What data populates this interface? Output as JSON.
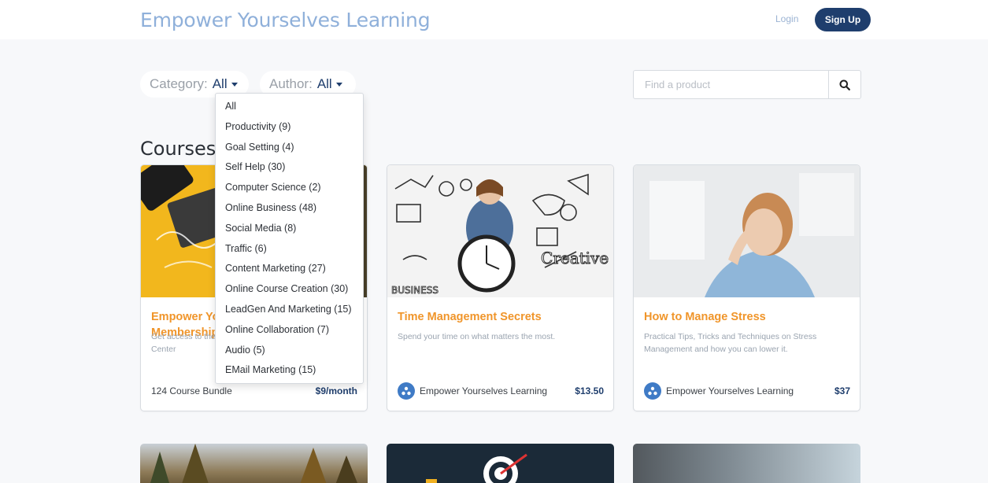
{
  "header": {
    "brand": "Empower Yourselves Learning",
    "login_label": "Login",
    "signup_label": "Sign Up"
  },
  "filters": {
    "category_label": "Category:",
    "category_value": "All",
    "author_label": "Author:",
    "author_value": "All"
  },
  "search": {
    "placeholder": "Find a product",
    "value": ""
  },
  "section_title": "Courses",
  "category_options": [
    "All",
    "Productivity (9)",
    "Goal Setting (4)",
    "Self Help (30)",
    "Computer Science (2)",
    "Online Business (48)",
    "Social Media (8)",
    "Traffic (6)",
    "Content Marketing (27)",
    "Online Course Creation (30)",
    "LeadGen And Marketing (15)",
    "Online Collaboration (7)",
    "Audio (5)",
    "EMail Marketing (15)"
  ],
  "cards": [
    {
      "title": "Empower Yourselves Learning Membership",
      "description": "Get access to the entire Empower Yourselves Learning Center",
      "meta": "124 Course Bundle",
      "price": "$9/month"
    },
    {
      "title": "Time Management Secrets",
      "description": "Spend your time on what matters the most.",
      "author": "Empower Yourselves Learning",
      "price": "$13.50"
    },
    {
      "title": "How to Manage Stress",
      "description": "Practical Tips, Tricks and Techniques on Stress Management and how you can lower it.",
      "author": "Empower Yourselves Learning",
      "price": "$37"
    }
  ],
  "colors": {
    "accent_orange": "#f0952a",
    "brand_navy": "#1f3e6d",
    "brand_light": "#8fb0da"
  },
  "icons": {
    "search": "search-icon",
    "caret": "caret-down-icon",
    "author_avatar": "author-logo-icon"
  }
}
